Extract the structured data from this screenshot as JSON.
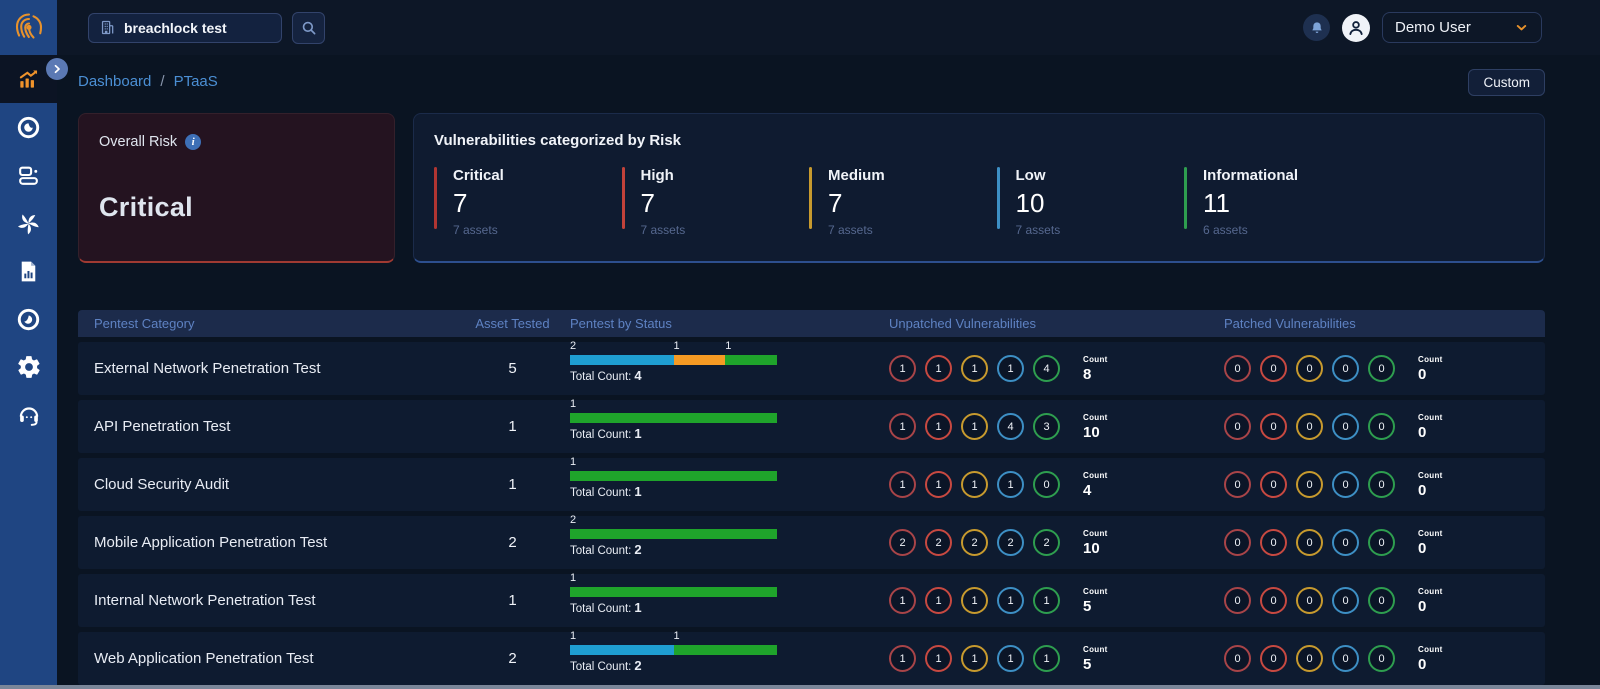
{
  "topbar": {
    "search_value": "breachlock test",
    "user_label": "Demo User"
  },
  "breadcrumb": {
    "items": [
      "Dashboard",
      "PTaaS"
    ],
    "separator": "/"
  },
  "custom_button_label": "Custom",
  "overall_risk": {
    "label": "Overall Risk",
    "value": "Critical"
  },
  "risk_panel": {
    "title": "Vulnerabilities categorized by Risk",
    "items": [
      {
        "label": "Critical",
        "value": "7",
        "assets": "7 assets",
        "color": "#b03532"
      },
      {
        "label": "High",
        "value": "7",
        "assets": "7 assets",
        "color": "#c2423a"
      },
      {
        "label": "Medium",
        "value": "7",
        "assets": "7 assets",
        "color": "#c79a2e"
      },
      {
        "label": "Low",
        "value": "10",
        "assets": "7 assets",
        "color": "#3d8fc4"
      },
      {
        "label": "Informational",
        "value": "11",
        "assets": "6 assets",
        "color": "#2e9e4f"
      }
    ]
  },
  "table": {
    "headers": [
      "Pentest Category",
      "Asset Tested",
      "Pentest by Status",
      "Unpatched Vulnerabilities",
      "Patched Vulnerabilities"
    ],
    "total_count_label": "Total Count:",
    "count_label": "Count",
    "status_colors": {
      "blue": "#1f9ed1",
      "orange": "#f59a23",
      "green": "#1fa42b"
    },
    "severity_ring_colors": [
      "#a84448",
      "#c74941",
      "#c79a2e",
      "#3d8fc4",
      "#2e9e4f"
    ],
    "rows": [
      {
        "category": "External Network Penetration Test",
        "assets_tested": "5",
        "status": {
          "segments": [
            {
              "value": 2,
              "color": "blue"
            },
            {
              "value": 1,
              "color": "orange"
            },
            {
              "value": 1,
              "color": "green"
            }
          ],
          "total": "4"
        },
        "unpatched": {
          "counts": [
            "1",
            "1",
            "1",
            "1",
            "4"
          ],
          "total": "8"
        },
        "patched": {
          "counts": [
            "0",
            "0",
            "0",
            "0",
            "0"
          ],
          "total": "0"
        }
      },
      {
        "category": "API Penetration Test",
        "assets_tested": "1",
        "status": {
          "segments": [
            {
              "value": 1,
              "color": "green"
            }
          ],
          "total": "1"
        },
        "unpatched": {
          "counts": [
            "1",
            "1",
            "1",
            "4",
            "3"
          ],
          "total": "10"
        },
        "patched": {
          "counts": [
            "0",
            "0",
            "0",
            "0",
            "0"
          ],
          "total": "0"
        }
      },
      {
        "category": "Cloud Security Audit",
        "assets_tested": "1",
        "status": {
          "segments": [
            {
              "value": 1,
              "color": "green"
            }
          ],
          "total": "1"
        },
        "unpatched": {
          "counts": [
            "1",
            "1",
            "1",
            "1",
            "0"
          ],
          "total": "4"
        },
        "patched": {
          "counts": [
            "0",
            "0",
            "0",
            "0",
            "0"
          ],
          "total": "0"
        }
      },
      {
        "category": "Mobile Application Penetration Test",
        "assets_tested": "2",
        "status": {
          "segments": [
            {
              "value": 2,
              "color": "green"
            }
          ],
          "total": "2"
        },
        "unpatched": {
          "counts": [
            "2",
            "2",
            "2",
            "2",
            "2"
          ],
          "total": "10"
        },
        "patched": {
          "counts": [
            "0",
            "0",
            "0",
            "0",
            "0"
          ],
          "total": "0"
        }
      },
      {
        "category": "Internal Network Penetration Test",
        "assets_tested": "1",
        "status": {
          "segments": [
            {
              "value": 1,
              "color": "green"
            }
          ],
          "total": "1"
        },
        "unpatched": {
          "counts": [
            "1",
            "1",
            "1",
            "1",
            "1"
          ],
          "total": "5"
        },
        "patched": {
          "counts": [
            "0",
            "0",
            "0",
            "0",
            "0"
          ],
          "total": "0"
        }
      },
      {
        "category": "Web Application Penetration Test",
        "assets_tested": "2",
        "status": {
          "segments": [
            {
              "value": 1,
              "color": "blue"
            },
            {
              "value": 1,
              "color": "green"
            }
          ],
          "total": "2"
        },
        "unpatched": {
          "counts": [
            "1",
            "1",
            "1",
            "1",
            "1"
          ],
          "total": "5"
        },
        "patched": {
          "counts": [
            "0",
            "0",
            "0",
            "0",
            "0"
          ],
          "total": "0"
        }
      }
    ]
  },
  "sidebar": {
    "items": [
      {
        "id": "dashboard",
        "icon": "trend-chart-icon",
        "active": true
      },
      {
        "id": "targets",
        "icon": "target-icon",
        "active": false
      },
      {
        "id": "assets",
        "icon": "assets-icon",
        "active": false
      },
      {
        "id": "automation",
        "icon": "spiral-icon",
        "active": false
      },
      {
        "id": "reports",
        "icon": "report-icon",
        "active": false
      },
      {
        "id": "monitoring",
        "icon": "target-dot-icon",
        "active": false
      },
      {
        "id": "settings",
        "icon": "gear-icon",
        "active": false
      },
      {
        "id": "support",
        "icon": "headset-icon",
        "active": false
      }
    ]
  }
}
